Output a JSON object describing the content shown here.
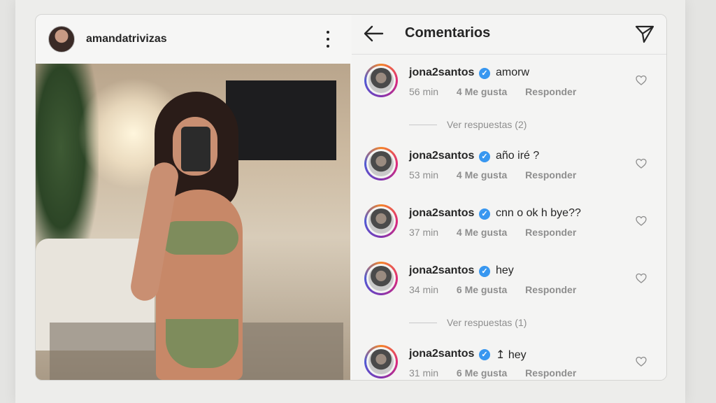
{
  "post": {
    "username": "amandatrivizas"
  },
  "comments_panel": {
    "title": "Comentarios"
  },
  "comments": [
    {
      "user": "jona2santos",
      "text": "amorw",
      "time": "56 min",
      "likes": "4 Me gusta",
      "reply": "Responder"
    },
    {
      "user": "jona2santos",
      "text": "año iré ?",
      "time": "53 min",
      "likes": "4 Me gusta",
      "reply": "Responder"
    },
    {
      "user": "jona2santos",
      "text": "cnn o ok h bye??",
      "time": "37 min",
      "likes": "4 Me gusta",
      "reply": "Responder"
    },
    {
      "user": "jona2santos",
      "text": "hey",
      "time": "34 min",
      "likes": "6 Me gusta",
      "reply": "Responder"
    },
    {
      "user": "jona2santos",
      "text": "↥ hey",
      "time": "31 min",
      "likes": "6 Me gusta",
      "reply": "Responder"
    }
  ],
  "view_replies": [
    "Ver respuestas (2)",
    "Ver respuestas (1)"
  ],
  "icons": {
    "back": "arrow-left-icon",
    "send": "send-icon",
    "like": "heart-icon",
    "more": "more-vertical-icon",
    "verified": "verified-badge-icon"
  },
  "colors": {
    "verified": "#3897f0",
    "text": "#262626",
    "muted": "#8e8e8e"
  }
}
